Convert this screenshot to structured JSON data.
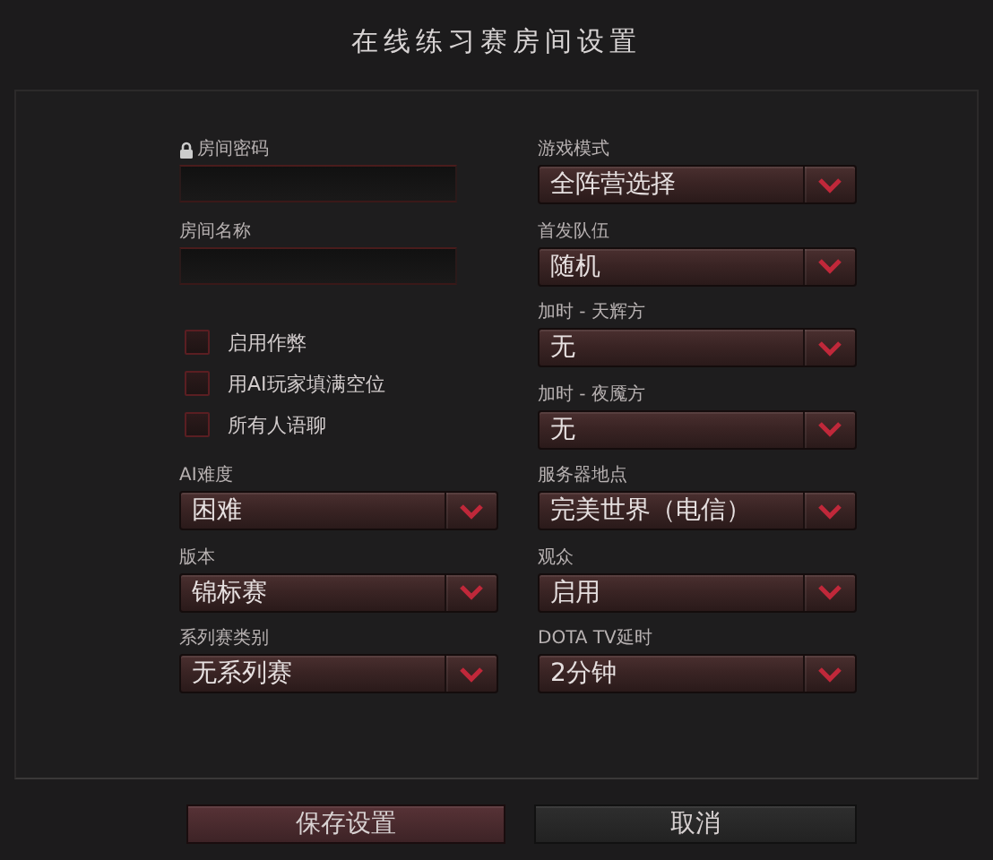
{
  "window": {
    "title": "在线练习赛房间设置"
  },
  "text_fields": [
    {
      "label": "房间密码",
      "locked": true
    },
    {
      "label": "房间名称",
      "locked": false
    }
  ],
  "checkboxes": [
    {
      "label": "启用作弊",
      "checked": false
    },
    {
      "label": "用AI玩家填满空位",
      "checked": false
    },
    {
      "label": "所有人语聊",
      "checked": false
    }
  ],
  "left_dropdowns": [
    {
      "label": "AI难度",
      "value": "困难"
    },
    {
      "label": "版本",
      "value": "锦标赛"
    },
    {
      "label": "系列赛类别",
      "value": "无系列赛"
    }
  ],
  "right_dropdowns": [
    {
      "label": "游戏模式",
      "value": "全阵营选择"
    },
    {
      "label": "首发队伍",
      "value": "随机"
    },
    {
      "label": "加时 - 天辉方",
      "value": "无"
    },
    {
      "label": "加时 - 夜魇方",
      "value": "无"
    },
    {
      "label": "服务器地点",
      "value": "完美世界（电信）"
    },
    {
      "label": "观众",
      "value": "启用"
    },
    {
      "label": "DOTA TV延时",
      "value": "2分钟"
    }
  ],
  "buttons": [
    {
      "label": "保存设置",
      "kind": "primary"
    },
    {
      "label": "取消",
      "kind": "secondary"
    }
  ]
}
